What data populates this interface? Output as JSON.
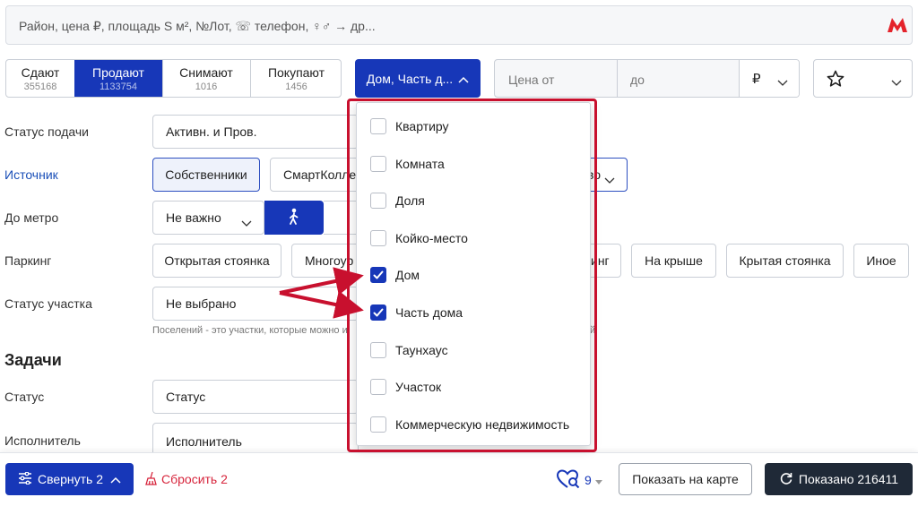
{
  "search": {
    "placeholder": "Район, цена ₽, площадь S м², №Лот, ☏ телефон, ♀♂ → др..."
  },
  "deal_tabs": [
    {
      "label": "Сдают",
      "count": "355168"
    },
    {
      "label": "Продают",
      "count": "1133754"
    },
    {
      "label": "Снимают",
      "count": "1016"
    },
    {
      "label": "Покупают",
      "count": "1456"
    }
  ],
  "type_dropdown": {
    "label": "Дом, Часть д..."
  },
  "price": {
    "from_placeholder": "Цена от",
    "to_placeholder": "до",
    "currency": "₽"
  },
  "filters": {
    "status_label": "Статус подачи",
    "status_value": "Активн. и Пров.",
    "source_label": "Источник",
    "source_opt1": "Собственники",
    "source_opt2": "СмартКоллег",
    "source_tail": "во",
    "metro_label": "До метро",
    "metro_value": "Не важно",
    "parking_label": "Паркинг",
    "parking_open": "Открытая стоянка",
    "parking_multi": "Многоур",
    "parking_tail": "инг",
    "parking_roof": "На крыше",
    "parking_covered": "Крытая стоянка",
    "parking_other": "Иное",
    "plot_status_label": "Статус участка",
    "plot_status_value": "Не выбрано",
    "plot_hint": "Поселений - это участки, которые можно и",
    "plot_hint_tail": "й"
  },
  "tasks": {
    "heading": "Задачи",
    "status_label": "Статус",
    "status_value": "Статус",
    "assignee_label": "Исполнитель",
    "assignee_value": "Исполнитель"
  },
  "property_types": [
    {
      "label": "Квартиру",
      "checked": false
    },
    {
      "label": "Комната",
      "checked": false
    },
    {
      "label": "Доля",
      "checked": false
    },
    {
      "label": "Койко-место",
      "checked": false
    },
    {
      "label": "Дом",
      "checked": true
    },
    {
      "label": "Часть дома",
      "checked": true
    },
    {
      "label": "Таунхаус",
      "checked": false
    },
    {
      "label": "Участок",
      "checked": false
    },
    {
      "label": "Коммерческую недвижимость",
      "checked": false
    }
  ],
  "bottom": {
    "collapse_label": "Свернуть 2",
    "reset_label": "Сбросить 2",
    "fav_count": "9",
    "map_label": "Показать на карте",
    "shown_label": "Показано 216411"
  },
  "colors": {
    "primary": "#1737b8",
    "annotation": "#c8102e",
    "reset": "#d7263d"
  },
  "icons": [
    "metro-logo-icon",
    "star-icon",
    "chevron-down-icon",
    "walker-icon",
    "sliders-icon",
    "broom-icon",
    "heart-search-icon",
    "refresh-icon",
    "check-icon"
  ]
}
